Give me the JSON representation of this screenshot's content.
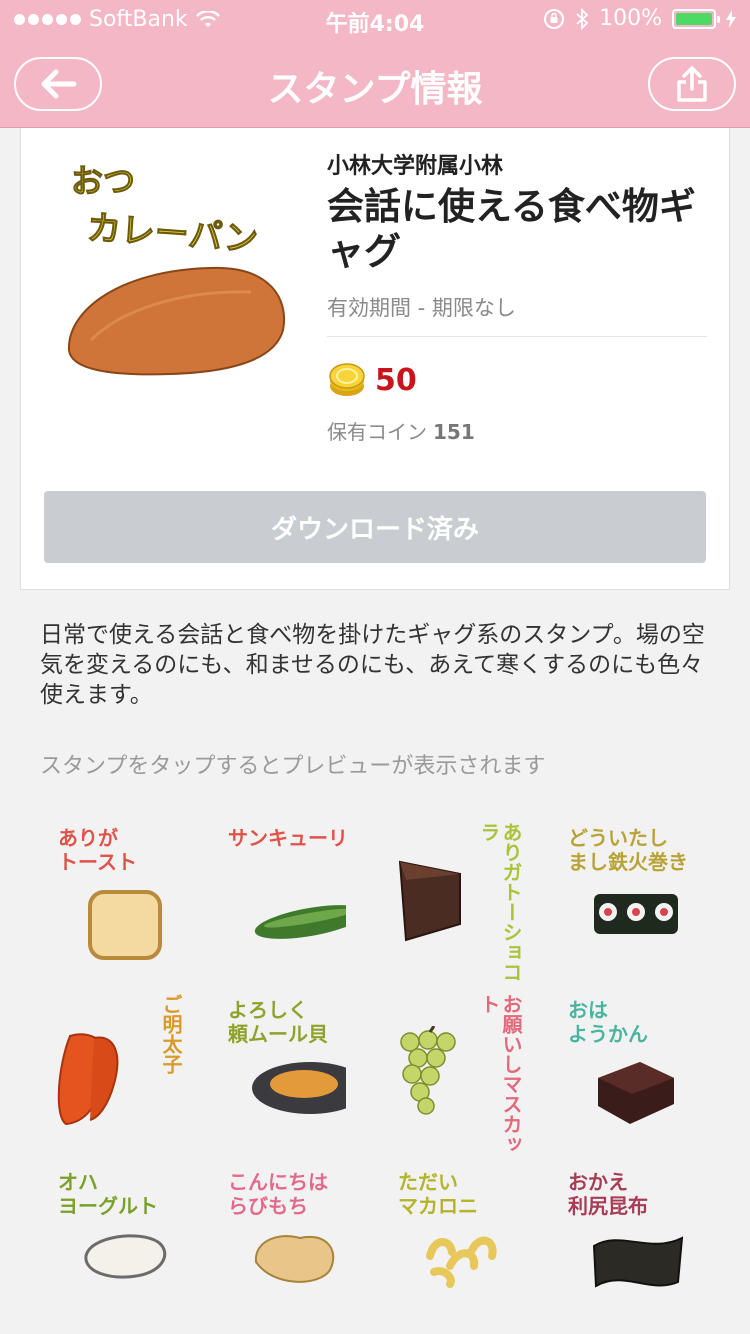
{
  "status_bar": {
    "carrier": "SoftBank",
    "time": "午前4:04",
    "battery": "100%",
    "battery_level": 1.0
  },
  "nav": {
    "title": "スタンプ情報",
    "back_icon": "back-arrow-icon",
    "share_icon": "share-icon"
  },
  "product": {
    "sticker_text_line1": "おつ",
    "sticker_text_line2": "カレーパン",
    "author": "小林大学附属小林",
    "title": "会話に使える食べ物ギャグ",
    "validity": "有効期間 - 期限なし",
    "price": "50",
    "owned_label": "保有コイン",
    "owned_value": "151",
    "download_label": "ダウンロード済み"
  },
  "description": "日常で使える会話と食べ物を掛けたギャグ系のスタンプ。場の空気を変えるのにも、和ませるのにも、あえて寒くするのにも色々使えます。",
  "hint": "スタンプをタップするとプレビューが表示されます",
  "stickers": [
    {
      "text": "ありが\nトースト",
      "color": "#e0534a",
      "icon": "toast-icon",
      "vertical": false
    },
    {
      "text": "サンキューリ",
      "color": "#e0534a",
      "icon": "cucumber-icon",
      "vertical": false
    },
    {
      "text": "ありガトーショコラ",
      "color": "#a9c43a",
      "icon": "chocolate-cake-icon",
      "vertical": true
    },
    {
      "text": "どういたし\nまし鉄火巻き",
      "color": "#b9a336",
      "icon": "sushi-roll-icon",
      "vertical": false
    },
    {
      "text": "ご明太子",
      "color": "#d99a2b",
      "icon": "mentaiko-icon",
      "vertical": true
    },
    {
      "text": "よろしく\n頼ムール貝",
      "color": "#8fa22a",
      "icon": "mussel-icon",
      "vertical": false
    },
    {
      "text": "お願いしマスカット",
      "color": "#e36a7c",
      "icon": "grapes-icon",
      "vertical": true
    },
    {
      "text": "おは\nようかん",
      "color": "#49b5a0",
      "icon": "yokan-icon",
      "vertical": false
    },
    {
      "text": "オハ\nヨーグルト",
      "color": "#7aa02a",
      "icon": "yogurt-icon",
      "vertical": false
    },
    {
      "text": "こんにちは\nらびもち",
      "color": "#e36a8a",
      "icon": "warabimochi-icon",
      "vertical": false
    },
    {
      "text": "ただい\nマカロニ",
      "color": "#b4b42a",
      "icon": "macaroni-icon",
      "vertical": false
    },
    {
      "text": "おかえ\n利尻昆布",
      "color": "#a83c55",
      "icon": "kelp-icon",
      "vertical": false
    }
  ]
}
